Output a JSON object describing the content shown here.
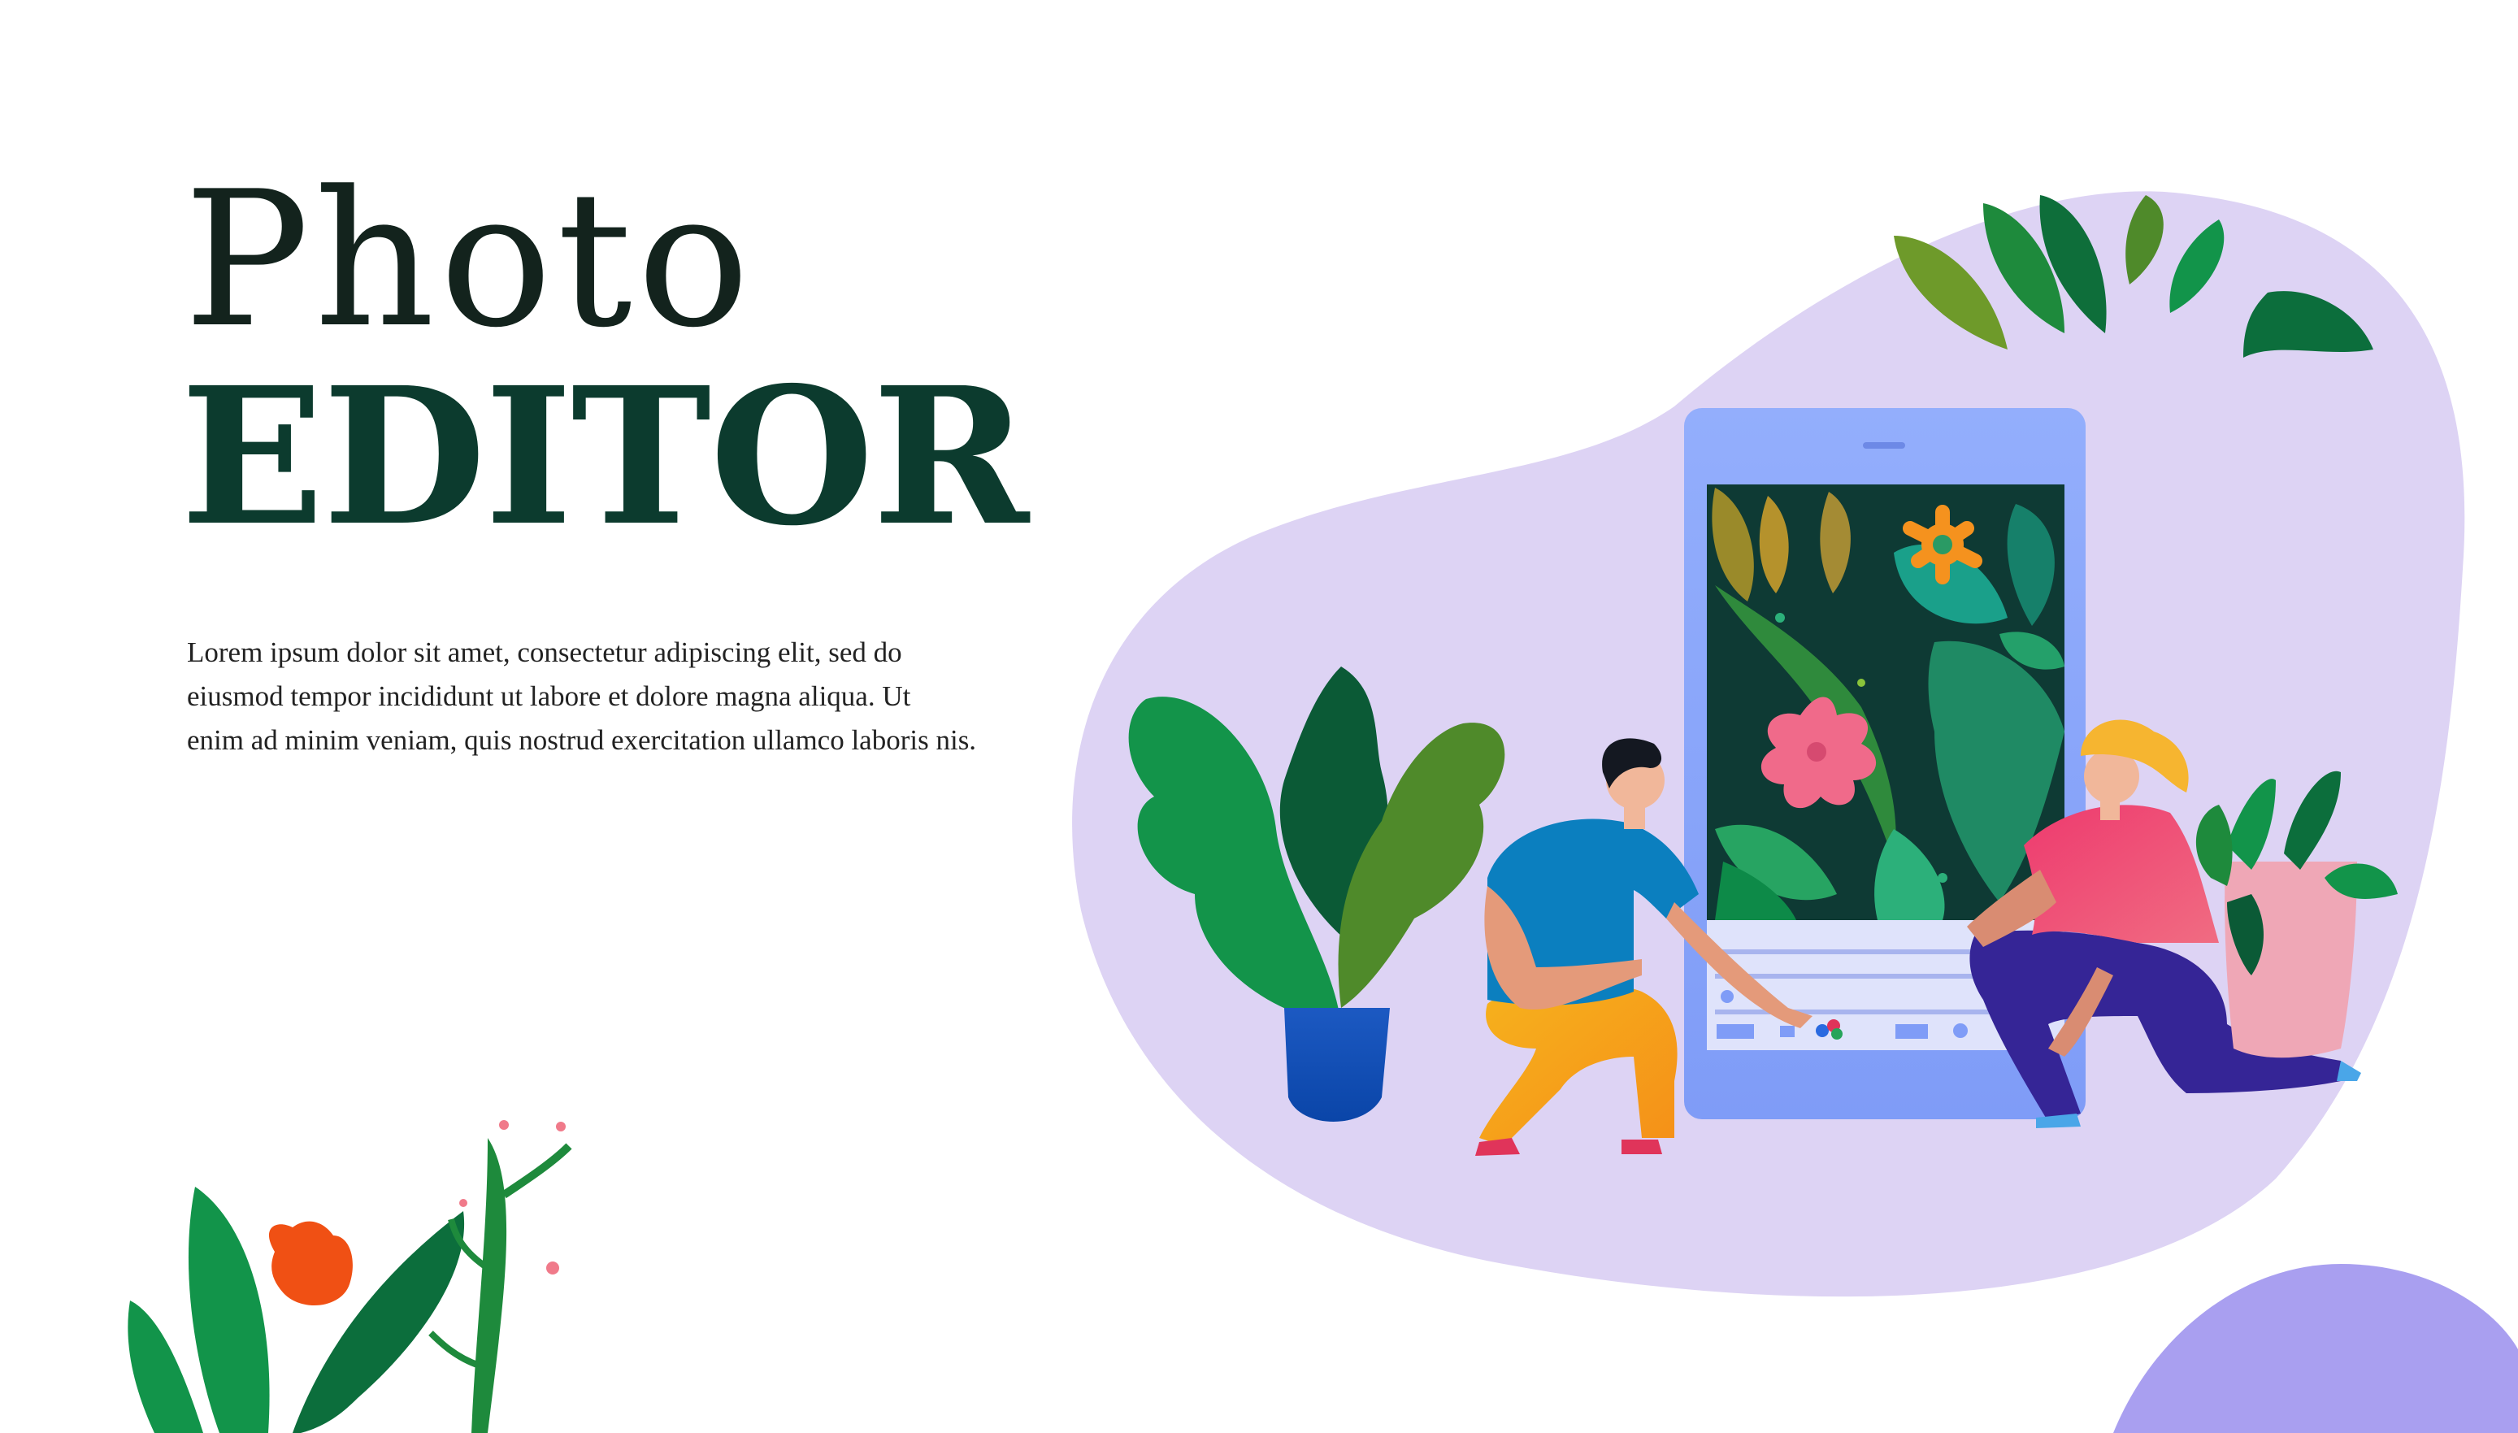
{
  "hero": {
    "title_light": "Photo",
    "title_bold": "EDITOR",
    "body_lines": [
      "Lorem ipsum dolor sit amet, consectetur adipiscing elit, sed do",
      "eiusmod tempor incididunt ut labore et dolore magna aliqua. Ut",
      "enim ad minim veniam, quis nostrud exercitation ullamco laboris nis."
    ]
  },
  "colors": {
    "title_dark": "#0c3b2e",
    "blob": "#ddd3f4",
    "corner_blob": "#a99ff0",
    "phone": "#8fa8fa",
    "leaf_green": "#12944a",
    "flower_pink": "#f06a8a",
    "flower_orange": "#f5921e"
  },
  "illustration": {
    "icons": [
      "phone-screen-icon",
      "man-figure-icon",
      "woman-figure-icon",
      "potted-plant-icon",
      "flower-icon",
      "leaf-icon"
    ]
  }
}
